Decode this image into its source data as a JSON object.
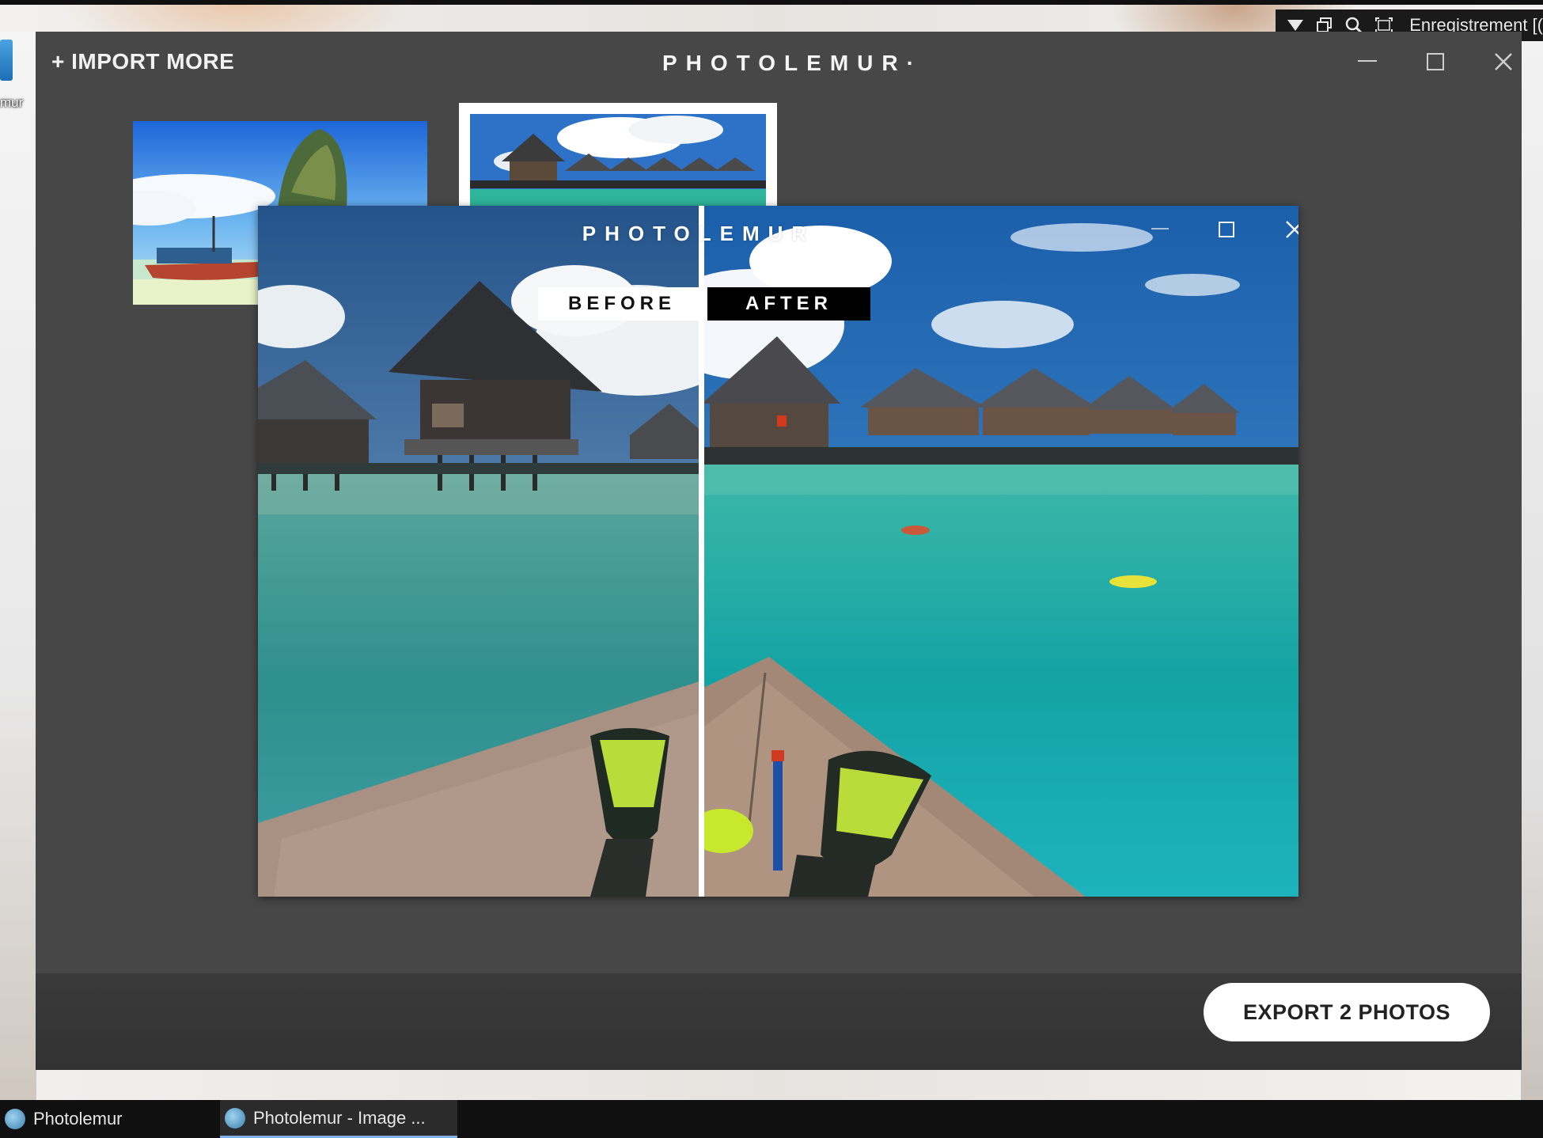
{
  "app": {
    "import_more": "+ IMPORT MORE",
    "brand": "PHOTOLEMUR",
    "brand_suffix": "·",
    "export_button": "EXPORT 2 PHOTOS"
  },
  "preview": {
    "brand": "PHOTOLEMUR",
    "before_label": "BEFORE",
    "after_label": "AFTER"
  },
  "recorder": {
    "label": "Enregistrement [("
  },
  "desktop": {
    "icon_label": "mur"
  },
  "taskbar": {
    "items": [
      {
        "label": "Photolemur"
      },
      {
        "label": "Photolemur - Image ..."
      }
    ]
  },
  "colors": {
    "window_bg": "#474747",
    "accent_white": "#ffffff",
    "taskbar_bg": "#101010"
  }
}
